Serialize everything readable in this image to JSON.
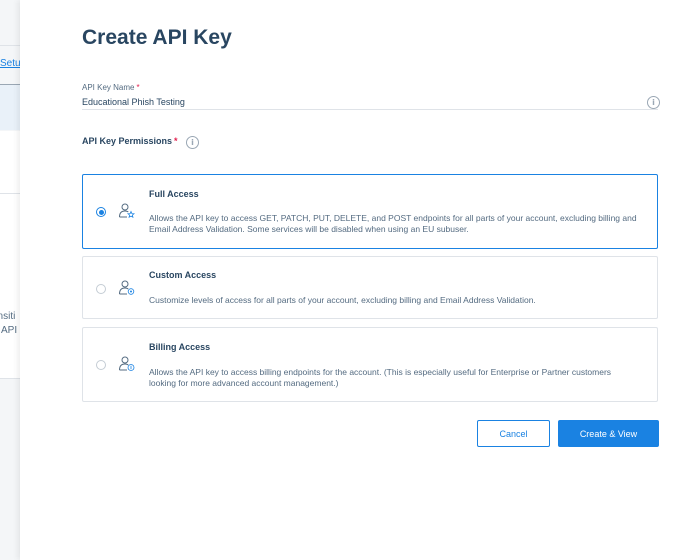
{
  "background": {
    "link_fragment": "Setu",
    "text_fragment_1": "ensiti",
    "text_fragment_2": "f API"
  },
  "modal": {
    "title": "Create API Key",
    "name_field": {
      "label": "API Key Name",
      "required_marker": "*",
      "value": "Educational Phish Testing",
      "info_icon": "info-icon"
    },
    "permissions": {
      "label": "API Key Permissions",
      "required_marker": "*",
      "info_icon": "info-icon",
      "selected": "Full Access",
      "options": [
        {
          "title": "Full Access",
          "description": "Allows the API key to access GET, PATCH, PUT, DELETE, and POST endpoints for all parts of your account, excluding billing and Email Address Validation. Some services will be disabled when using an EU subuser.",
          "icon": "user-star-icon",
          "checked": true
        },
        {
          "title": "Custom Access",
          "description": "Customize levels of access for all parts of your account, excluding billing and Email Address Validation.",
          "icon": "user-settings-icon",
          "checked": false
        },
        {
          "title": "Billing Access",
          "description": "Allows the API key to access billing endpoints for the account. (This is especially useful for Enterprise or Partner customers looking for more advanced account management.)",
          "icon": "user-billing-icon",
          "checked": false
        }
      ]
    },
    "buttons": {
      "cancel": "Cancel",
      "create": "Create & View"
    }
  },
  "colors": {
    "accent": "#1a82e2",
    "heading": "#294661",
    "required": "#e3214f",
    "border": "#dfe3e8"
  }
}
